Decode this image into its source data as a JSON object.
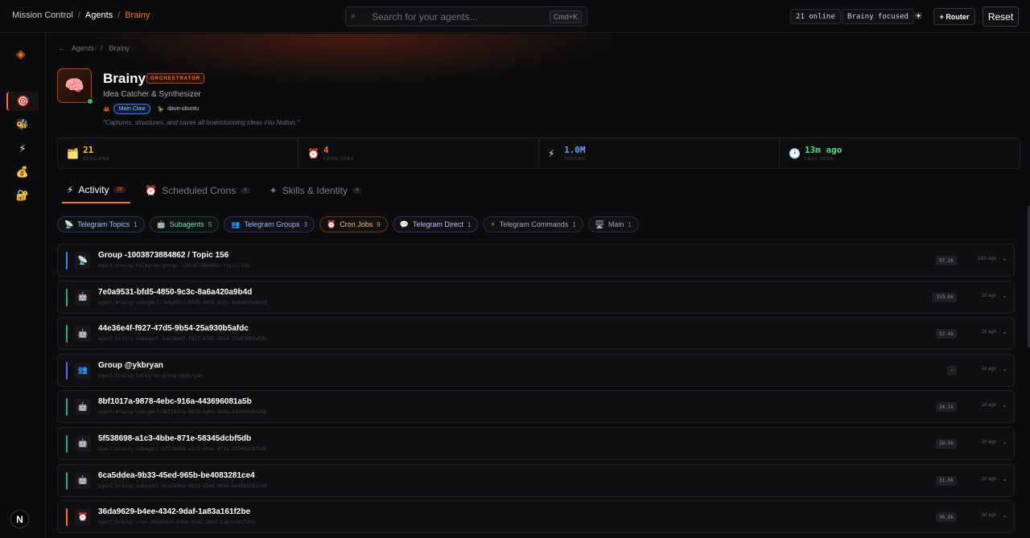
{
  "breadcrumb": [
    "Mission Control",
    "Agents",
    "Brainy"
  ],
  "search": {
    "placeholder": "Search for your agents...",
    "shortcut": "Cmd+K"
  },
  "status": {
    "online": "21 online",
    "focused": "Brainy focused"
  },
  "buttons": {
    "router": "+ Router",
    "reset": "Reset"
  },
  "sidebar": {
    "logo": "◈",
    "items": [
      {
        "icon": "🎯",
        "name": "target-icon",
        "active": true
      },
      {
        "icon": "🐝",
        "name": "bee-icon",
        "active": false
      },
      {
        "icon": "⚡",
        "name": "lightning-icon",
        "active": false
      },
      {
        "icon": "💰",
        "name": "money-bag-icon",
        "active": false
      },
      {
        "icon": "🔐",
        "name": "lock-icon",
        "active": false
      }
    ],
    "user_initial": "N"
  },
  "agent": {
    "back_label": "Agents",
    "back_current": "Brainy",
    "avatar": "🧠",
    "name": "Brainy",
    "role": "ORCHESTRATOR",
    "subtitle": "Idea Catcher & Synthesizer",
    "claw": "Main Claw",
    "host": "dave-ubuntu",
    "quote": "\"Captures, structures, and saves all brainstorming ideas into Notion.\""
  },
  "stats": [
    {
      "icon": "🗂️",
      "value": "21",
      "label": "SESSIONS",
      "color": "#facc15"
    },
    {
      "icon": "⏰",
      "value": "4",
      "label": "CRON JOBS",
      "color": "#f97316"
    },
    {
      "icon": "⚡",
      "value": "1.0M",
      "label": "TOKENS",
      "color": "#60a5fa"
    },
    {
      "icon": "🕐",
      "value": "13m ago",
      "label": "LAST SEEN",
      "color": "#4ade80"
    }
  ],
  "tabs": [
    {
      "icon": "⚡",
      "label": "Activity",
      "count": "28",
      "active": true
    },
    {
      "icon": "⏰",
      "label": "Scheduled Crons",
      "count": "4",
      "active": false
    },
    {
      "icon": "✦",
      "label": "Skills & Identity",
      "count": "4",
      "active": false
    }
  ],
  "filters": [
    {
      "icon": "📡",
      "label": "Telegram Topics",
      "count": "1",
      "color": "#93c5fd",
      "border": "#1e3a5f"
    },
    {
      "icon": "🤖",
      "label": "Subagents",
      "count": "5",
      "color": "#6ee7b7",
      "border": "#14463a"
    },
    {
      "icon": "👥",
      "label": "Telegram Groups",
      "count": "3",
      "color": "#a5b4fc",
      "border": "#2e2f66"
    },
    {
      "icon": "⏰",
      "label": "Cron Jobs",
      "count": "9",
      "color": "#fdba74",
      "border": "#6b3510"
    },
    {
      "icon": "💬",
      "label": "Telegram Direct",
      "count": "1",
      "color": "#c4b5fd",
      "border": "#3b2a66"
    },
    {
      "icon": "⚡",
      "label": "Telegram Commands",
      "count": "1",
      "color": "#a8a8ae",
      "border": "#2a2a30"
    },
    {
      "icon": "🖥️",
      "label": "Main",
      "count": "1",
      "color": "#a8a8ae",
      "border": "#2a2a30"
    }
  ],
  "sessions": [
    {
      "icon": "📡",
      "title": "Group -1003873884862 / Topic 156",
      "key": "agent:brainy:telegram:group:-1003873884862:topic:156",
      "tokens": "97.2k",
      "ago": "13m ago",
      "color": "#3b82f6"
    },
    {
      "icon": "🤖",
      "title": "7e0a9531-bfd5-4850-9c3c-8a6a420a9b4d",
      "key": "agent:brainy:subagent:7e0a9531-bfd5-4850-9c3c-8a6a420a9b4d",
      "tokens": "159.6k",
      "ago": "2d ago",
      "color": "#10b981"
    },
    {
      "icon": "🤖",
      "title": "44e36e4f-f927-47d5-9b54-25a930b5afdc",
      "key": "agent:brainy:subagent:44e36e4f-f927-47d5-9b54-25a930b5afdc",
      "tokens": "52.4k",
      "ago": "2d ago",
      "color": "#10b981"
    },
    {
      "icon": "👥",
      "title": "Group @ykbryan",
      "key": "agent:brainy:telegram:group:@ykbryan",
      "tokens": "—",
      "ago": "2d ago",
      "color": "#6366f1"
    },
    {
      "icon": "🤖",
      "title": "8bf1017a-9878-4ebc-916a-443696081a5b",
      "key": "agent:brainy:subagent:8bf1017a-9878-4ebc-916a-443696081a5b",
      "tokens": "24.1k",
      "ago": "2d ago",
      "color": "#10b981"
    },
    {
      "icon": "🤖",
      "title": "5f538698-a1c3-4bbe-871e-58345dcbf5db",
      "key": "agent:brainy:subagent:5f538698-a1c3-4bbe-871e-58345dcbf5db",
      "tokens": "58.9k",
      "ago": "2d ago",
      "color": "#10b981"
    },
    {
      "icon": "🤖",
      "title": "6ca5ddea-9b33-45ed-965b-be4083281ce4",
      "key": "agent:brainy:subagent:6ca5ddea-9b33-45ed-965b-be4083281ce4",
      "tokens": "31.9k",
      "ago": "2d ago",
      "color": "#10b981"
    },
    {
      "icon": "⏰",
      "title": "36da9629-b4ee-4342-9daf-1a83a161f2be",
      "key": "agent:brainy:cron:36da9629-b4ee-4342-9daf-1a83a161f2be",
      "tokens": "36.8k",
      "ago": "3d ago",
      "color": "#f97316"
    }
  ]
}
